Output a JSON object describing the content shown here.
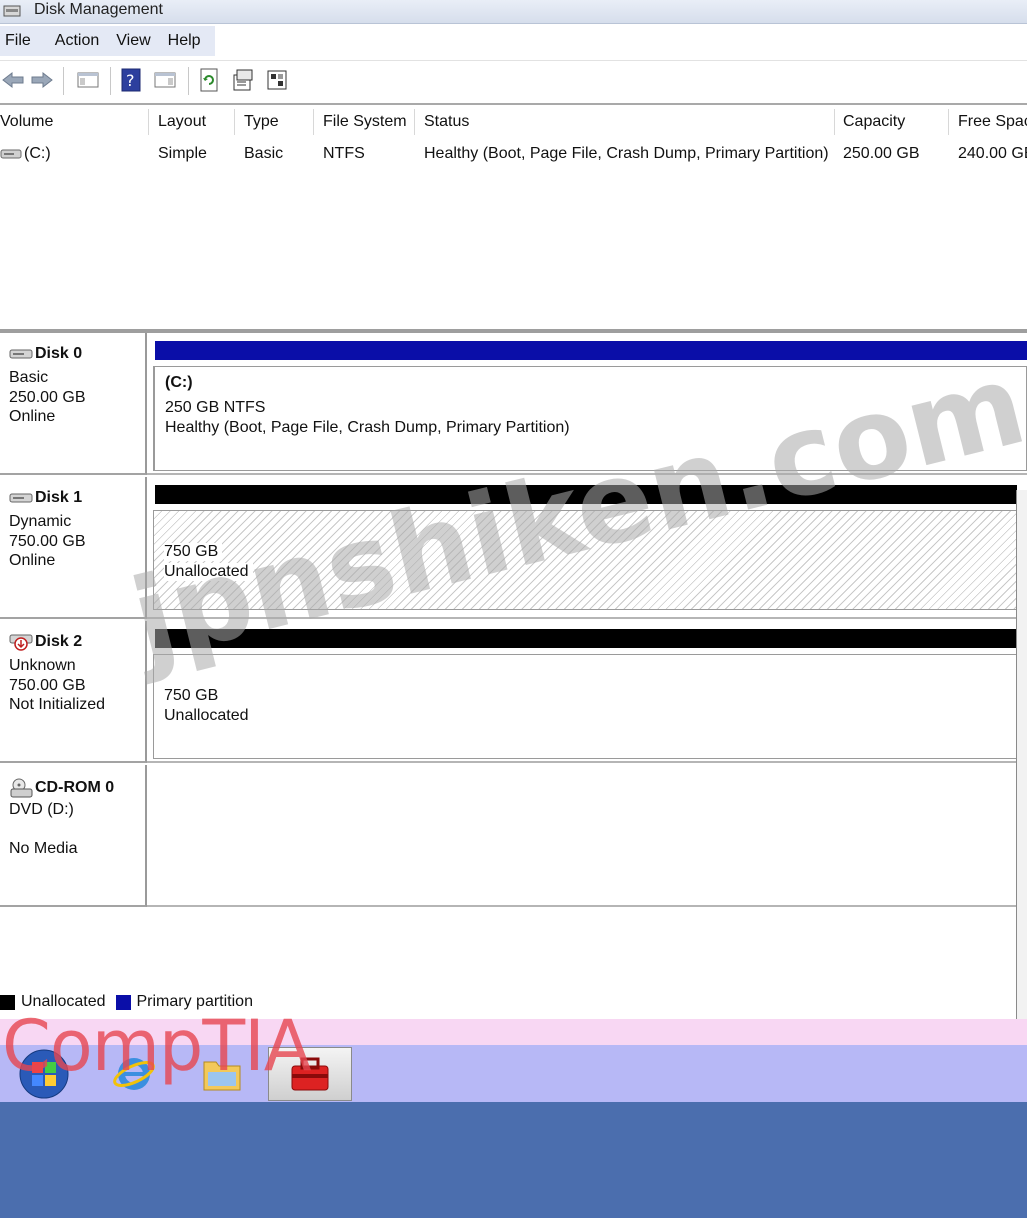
{
  "window": {
    "title": "Disk Management"
  },
  "menu": [
    "File",
    "Action",
    "View",
    "Help"
  ],
  "toolbar": {
    "buttons": [
      "back-icon",
      "forward-icon",
      "show-hide-console-tree-icon",
      "help-icon",
      "show-hide-action-pane-icon",
      "refresh-icon",
      "properties-icon",
      "settings-icon"
    ]
  },
  "volume_list": {
    "columns": [
      "Volume",
      "Layout",
      "Type",
      "File System",
      "Status",
      "Capacity",
      "Free Spac"
    ],
    "rows": [
      {
        "volume": "(C:)",
        "layout": "Simple",
        "type": "Basic",
        "fs": "NTFS",
        "status": "Healthy (Boot, Page File, Crash Dump, Primary Partition)",
        "capacity": "250.00 GB",
        "free": "240.00 GE"
      }
    ]
  },
  "disks": [
    {
      "name": "Disk 0",
      "type": "Basic",
      "size": "250.00 GB",
      "state": "Online",
      "bar_color": "#0a0ea8",
      "partition": {
        "title": "(C:)",
        "size": "250 GB NTFS",
        "status": "Healthy (Boot, Page File, Crash Dump, Primary Partition)"
      }
    },
    {
      "name": "Disk 1",
      "type": "Dynamic",
      "size": "750.00 GB",
      "state": "Online",
      "bar_color": "#000000",
      "partition": {
        "size": "750 GB",
        "status": "Unallocated"
      }
    },
    {
      "name": "Disk 2",
      "type": "Unknown",
      "size": "750.00 GB",
      "state": "Not Initialized",
      "bar_color": "#000000",
      "partition": {
        "size": "750 GB",
        "status": "Unallocated"
      }
    },
    {
      "name": "CD-ROM 0",
      "type": "DVD (D:)",
      "state": "No Media"
    }
  ],
  "legend": [
    {
      "label": "Unallocated",
      "color": "#000000"
    },
    {
      "label": "Primary partition",
      "color": "#0a0ea8"
    }
  ],
  "taskbar": {
    "items": [
      "start-orb-icon",
      "internet-explorer-icon",
      "windows-explorer-icon",
      "computer-management-icon"
    ]
  },
  "overlays": {
    "watermark": "jpnshiken.com",
    "brand": "CompTIA"
  },
  "colors": {
    "taskbar": "#b7b8f6",
    "desktop": "#4b6eae",
    "strip": "#f8d7f3"
  }
}
